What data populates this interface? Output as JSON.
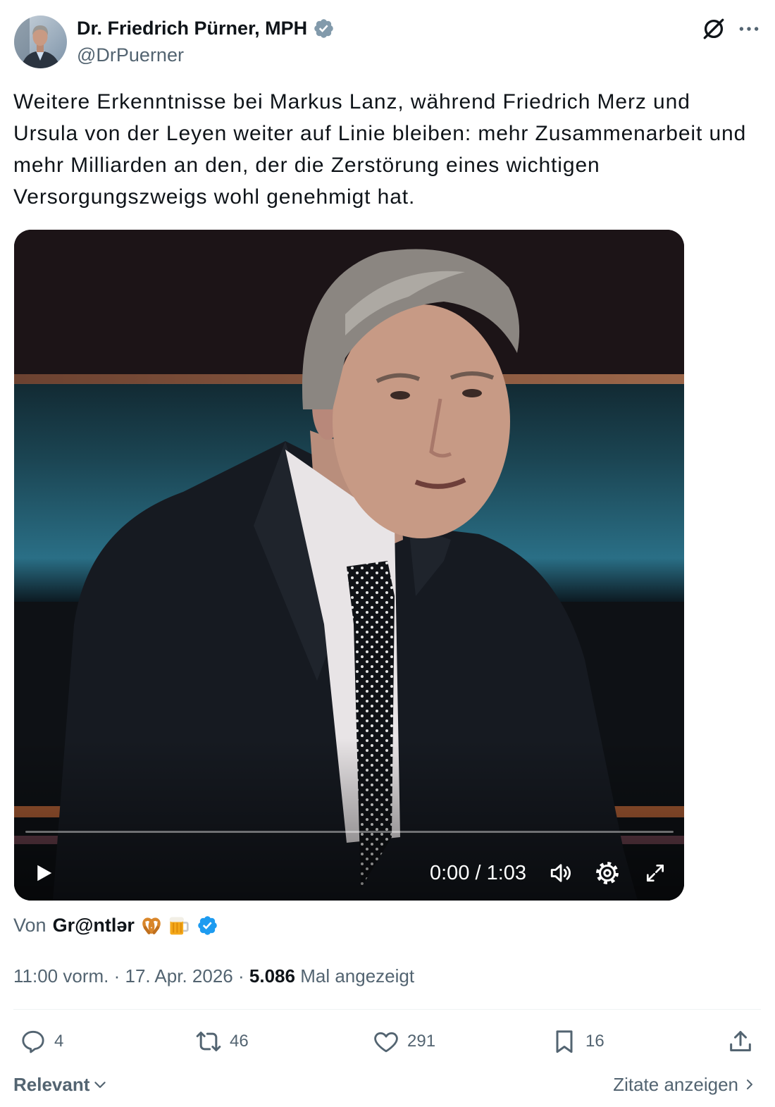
{
  "author": {
    "name": "Dr. Friedrich Pürner, MPH",
    "handle": "@DrPuerner",
    "badge_icon": "verified-badge-icon",
    "badge_color": "#829aab",
    "avatar_icon": "avatar-photo"
  },
  "header": {
    "grok_icon": "grok-icon",
    "more_icon": "more-icon"
  },
  "tweet": {
    "text_lines": [
      "Weitere Erkenntnisse bei Markus Lanz, während Friedrich Merz und",
      "Ursula von der Leyen weiter auf Linie bleiben: mehr Zusammenarbeit und",
      "mehr Milliarden an den, der die Zerstörung eines wichtigen",
      "Versorgungszweigs wohl genehmigt hat."
    ]
  },
  "video": {
    "time_display": "0:00 / 1:03",
    "progress_fraction": 0,
    "icons": [
      "play-icon",
      "volume-icon",
      "settings-icon",
      "fullscreen-icon"
    ]
  },
  "attribution": {
    "prefix": "Von",
    "name": "Gr@ntlər",
    "emoji_icons": [
      "pretzel-emoji-icon",
      "beer-mug-emoji-icon"
    ],
    "badge_color": "#1d9bf0"
  },
  "meta": {
    "time": "11:00 vorm.",
    "separator": "·",
    "date": "17. Apr. 2026",
    "views": "5.086",
    "views_label": "Mal angezeigt"
  },
  "actions": {
    "replies": "4",
    "reposts": "46",
    "likes": "291",
    "bookmarks": "16",
    "icons": [
      "reply-icon",
      "repost-icon",
      "like-icon",
      "bookmark-icon",
      "share-icon"
    ]
  },
  "footer": {
    "sort_label": "Relevant",
    "quotes_label": "Zitate anzeigen"
  },
  "colors": {
    "text": "#0f1419",
    "secondary": "#536471",
    "accent": "#1d9bf0",
    "divider": "#eff3f4"
  }
}
